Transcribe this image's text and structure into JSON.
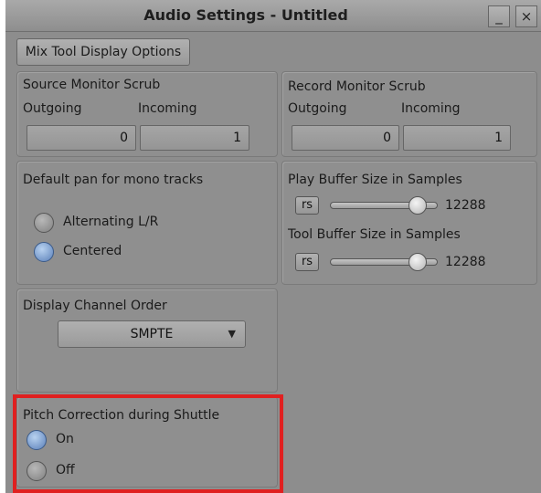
{
  "window": {
    "title": "Audio Settings - Untitled",
    "minimize_glyph": "_",
    "close_glyph": "×"
  },
  "mix_tool_button": "Mix Tool Display Options",
  "source_monitor": {
    "title": "Source Monitor Scrub",
    "outgoing_label": "Outgoing",
    "incoming_label": "Incoming",
    "outgoing_value": "0",
    "incoming_value": "1"
  },
  "record_monitor": {
    "title": "Record Monitor Scrub",
    "outgoing_label": "Outgoing",
    "incoming_label": "Incoming",
    "outgoing_value": "0",
    "incoming_value": "1"
  },
  "default_pan": {
    "title": "Default pan for mono tracks",
    "options": [
      "Alternating L/R",
      "Centered"
    ],
    "selected": "Centered"
  },
  "buffer": {
    "play_label": "Play Buffer Size in Samples",
    "play_reset": "rs",
    "play_value": "12288",
    "tool_label": "Tool Buffer Size in Samples",
    "tool_reset": "rs",
    "tool_value": "12288"
  },
  "channel_order": {
    "title": "Display Channel Order",
    "selected": "SMPTE",
    "arrow_glyph": "▼"
  },
  "pitch_correction": {
    "title": "Pitch Correction during Shuttle",
    "options": [
      "On",
      "Off"
    ],
    "selected": "On",
    "highlight_color": "#e02020"
  }
}
